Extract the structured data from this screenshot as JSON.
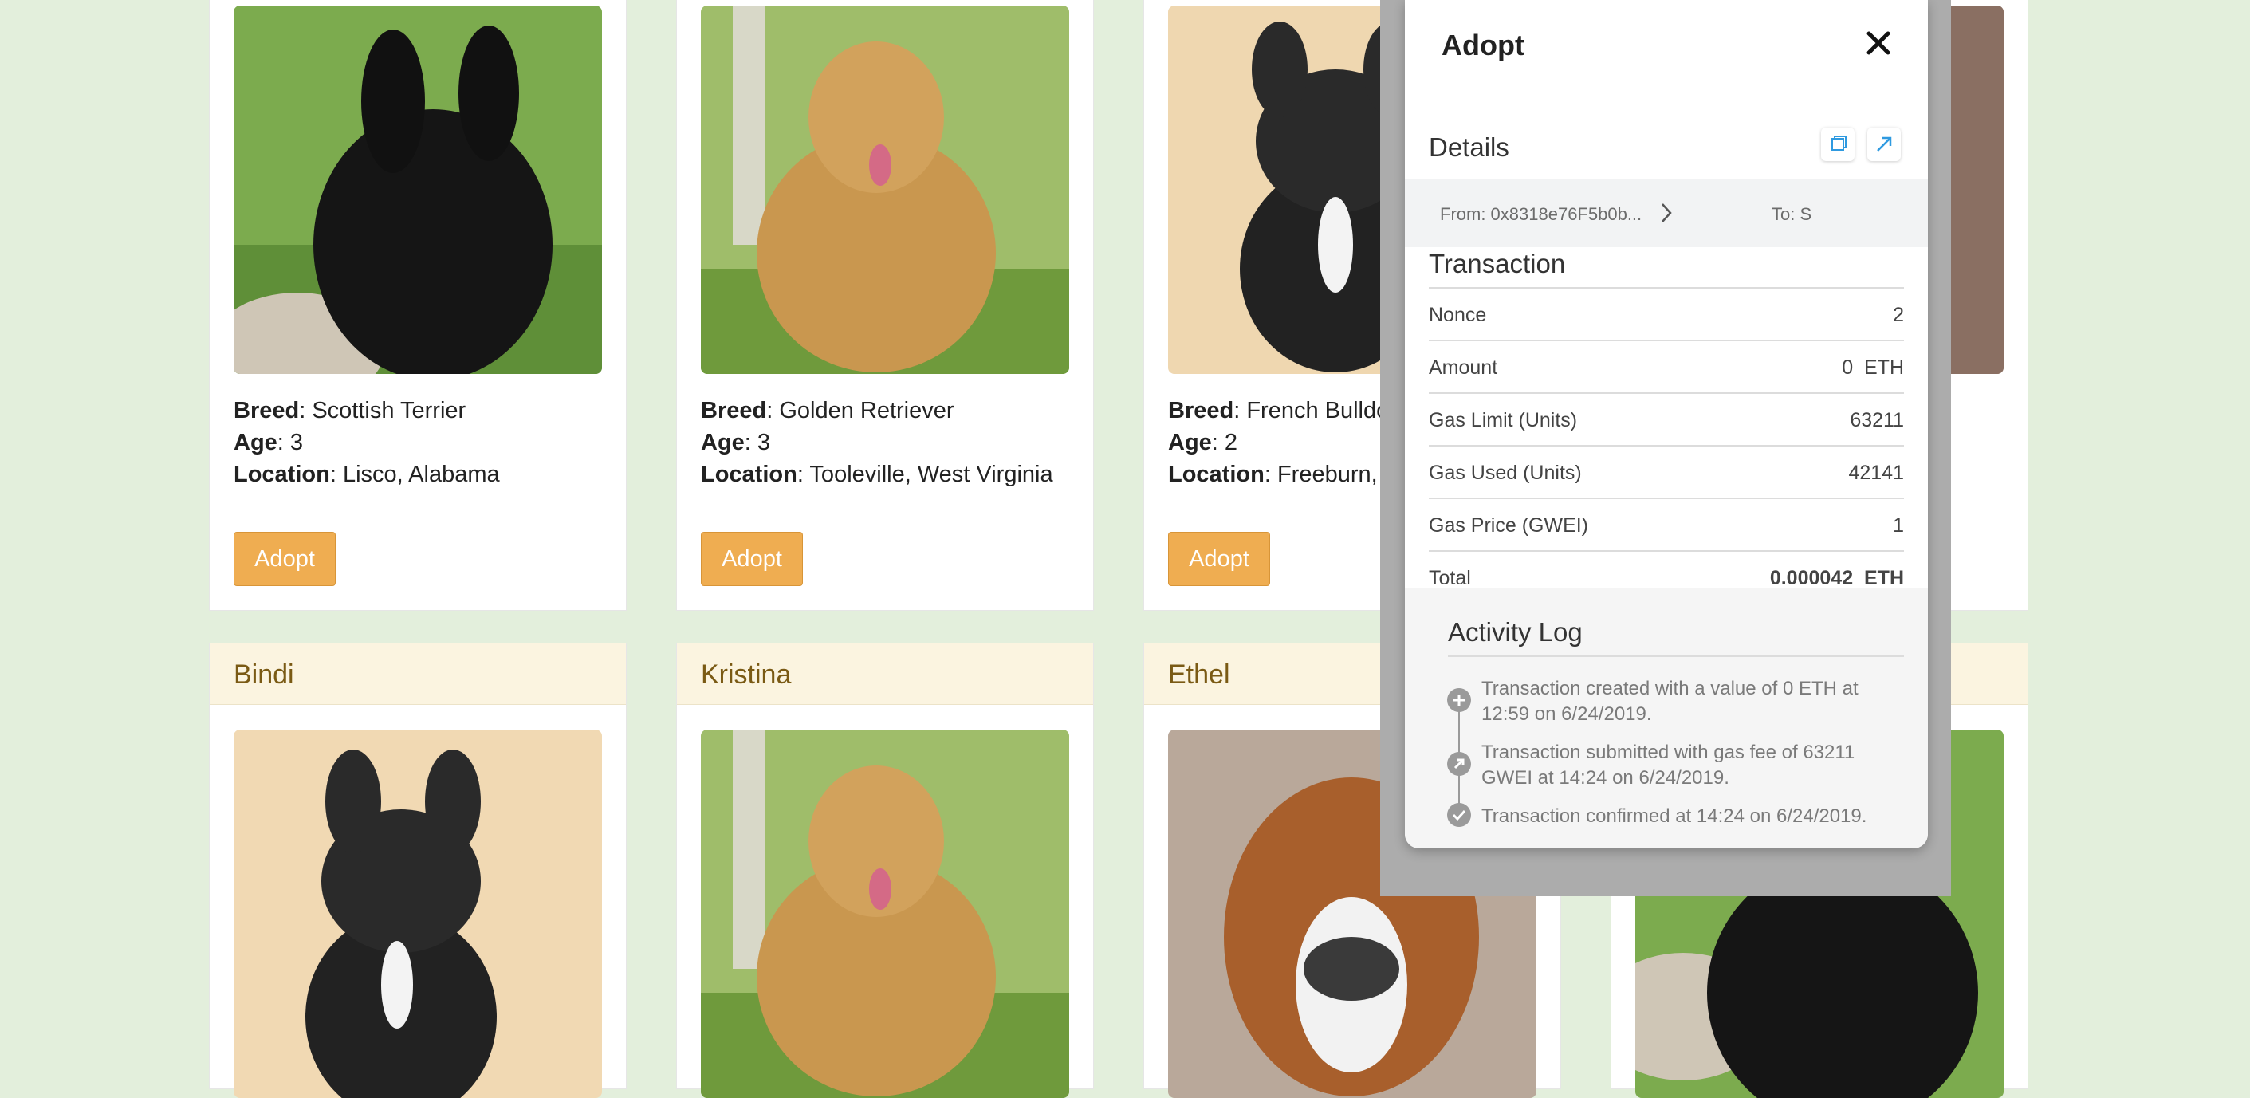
{
  "cards_top": [
    {
      "breed_label": "Breed",
      "breed": ": Scottish Terrier",
      "age_label": "Age",
      "age": ": 3",
      "location_label": "Location",
      "location": ": Lisco, Alabama",
      "button": "Adopt"
    },
    {
      "breed_label": "Breed",
      "breed": ": Golden Retriever",
      "age_label": "Age",
      "age": ": 3",
      "location_label": "Location",
      "location": ": Tooleville, West Virginia",
      "button": "Adopt"
    },
    {
      "breed_label": "Breed",
      "breed": ": French Bulldo",
      "age_label": "Age",
      "age": ": 2",
      "location_label": "Location",
      "location": ": Freeburn, I",
      "button": "Adopt"
    }
  ],
  "cards_bottom": [
    {
      "name": "Bindi"
    },
    {
      "name": "Kristina"
    },
    {
      "name": "Ethel"
    }
  ],
  "modal": {
    "title": "Adopt",
    "details_title": "Details",
    "from": "From: 0x8318e76F5b0b...",
    "to": "To: S",
    "transaction_title": "Transaction",
    "rows": [
      {
        "label": "Nonce",
        "value": "2"
      },
      {
        "label": "Amount",
        "value": "0  ETH"
      },
      {
        "label": "Gas Limit (Units)",
        "value": "63211"
      },
      {
        "label": "Gas Used (Units)",
        "value": "42141"
      },
      {
        "label": "Gas Price (GWEI)",
        "value": "1"
      },
      {
        "label": "Total",
        "value": "0.000042  ETH"
      }
    ],
    "activity_title": "Activity Log",
    "log": [
      "Transaction created with a value of 0 ETH at 12:59 on 6/24/2019.",
      "Transaction submitted with gas fee of 63211 GWEI at 14:24 on 6/24/2019.",
      "Transaction confirmed at 14:24 on 6/24/2019."
    ]
  },
  "colors": {
    "background": "#e3efdc",
    "button": "#efad51",
    "card_header": "#fbf4e0"
  },
  "icons": [
    "close-icon",
    "copy-icon",
    "external-link-icon",
    "chevron-right-icon",
    "plus-circle-icon",
    "arrow-circle-icon",
    "check-circle-icon"
  ]
}
